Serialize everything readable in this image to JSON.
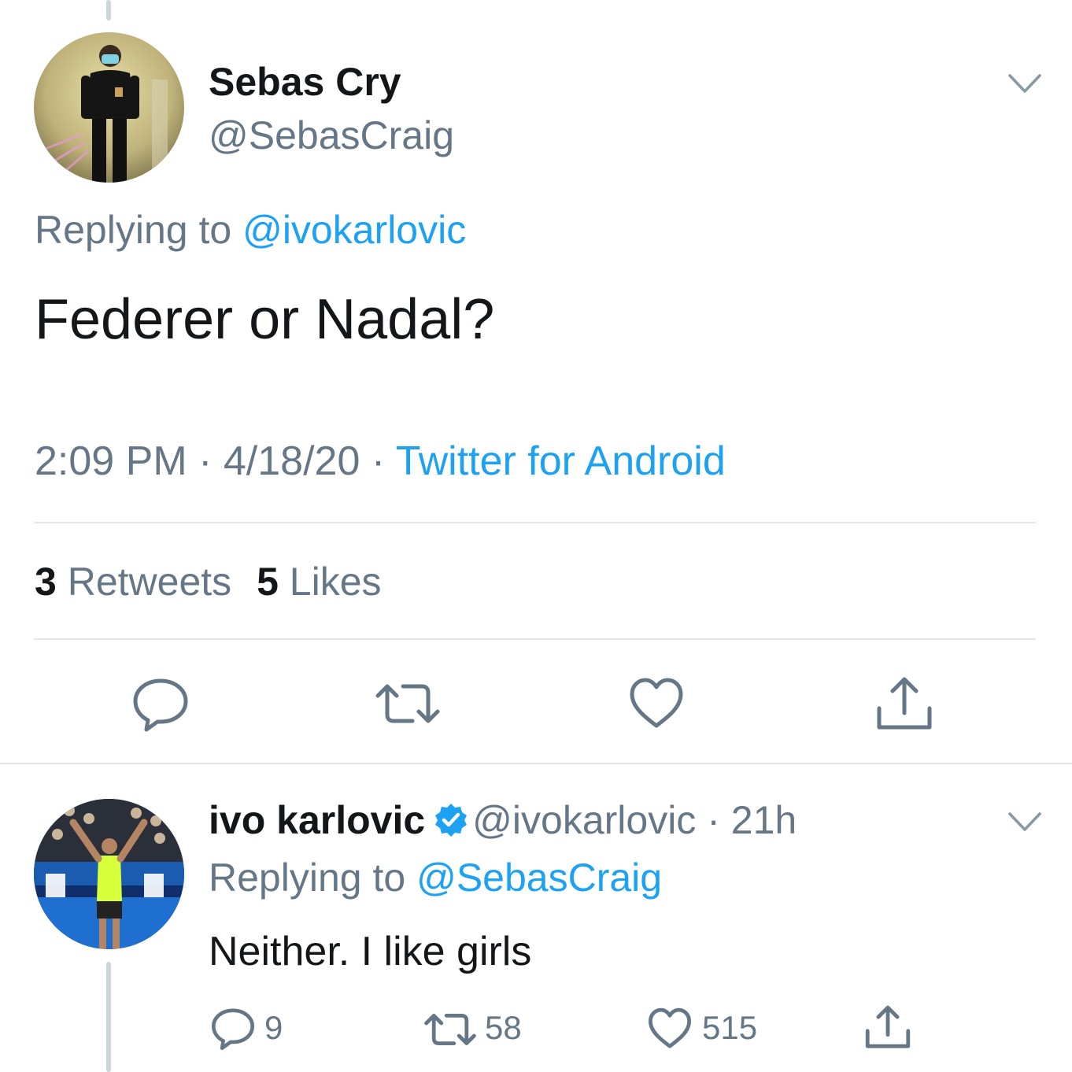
{
  "main_tweet": {
    "author_name": "Sebas Cry",
    "author_handle": "@SebasCraig",
    "replying_prefix": "Replying to",
    "replying_to": "@ivokarlovic",
    "text": "Federer or Nadal?",
    "time": "2:09 PM",
    "date": "4/18/20",
    "separator": "·",
    "client": "Twitter for Android",
    "retweets_count": "3",
    "retweets_label": "Retweets",
    "likes_count": "5",
    "likes_label": "Likes",
    "actions": [
      "reply-icon",
      "retweet-icon",
      "like-icon",
      "share-icon"
    ]
  },
  "reply_tweet": {
    "author_name": "ivo karlovic",
    "verified": true,
    "author_handle": "@ivokarlovic",
    "separator": "·",
    "age": "21h",
    "replying_prefix": "Replying to",
    "replying_to": "@SebasCraig",
    "text": "Neither. I like girls",
    "reply_count": "9",
    "retweet_count": "58",
    "like_count": "515",
    "actions": [
      "reply-icon",
      "retweet-icon",
      "like-icon",
      "share-icon"
    ]
  },
  "colors": {
    "accent": "#1da1f2",
    "secondary_text": "#657786",
    "primary_text": "#14171a",
    "divider": "#e1e8ed"
  }
}
